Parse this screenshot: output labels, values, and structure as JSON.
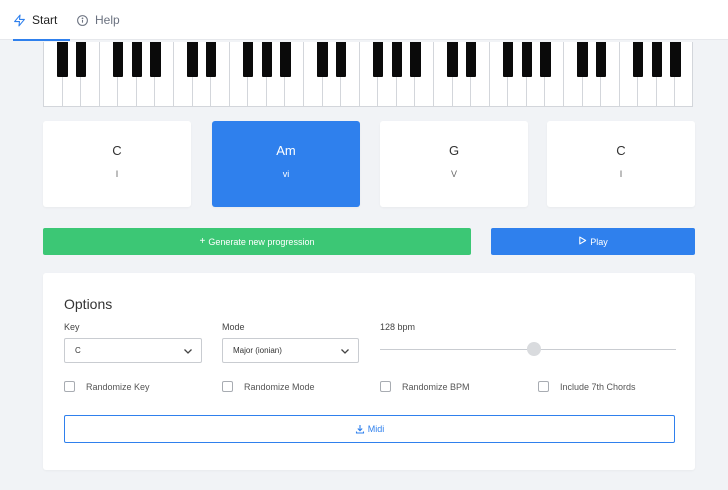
{
  "nav": {
    "tabs": [
      {
        "label": "Start",
        "icon": "lightning-icon",
        "active": true
      },
      {
        "label": "Help",
        "icon": "info-circle-icon",
        "active": false
      }
    ]
  },
  "piano": {
    "white_key_count": 35,
    "octaves": 5
  },
  "chords": [
    {
      "name": "C",
      "roman": "I",
      "active": false
    },
    {
      "name": "Am",
      "roman": "vi",
      "active": true
    },
    {
      "name": "G",
      "roman": "V",
      "active": false
    },
    {
      "name": "C",
      "roman": "I",
      "active": false
    }
  ],
  "actions": {
    "generate_label": "Generate new progression",
    "generate_icon": "plus-icon",
    "play_label": "Play",
    "play_icon": "play-icon"
  },
  "options": {
    "title": "Options",
    "key_label": "Key",
    "key_value": "C",
    "mode_label": "Mode",
    "mode_value": "Major (ionian)",
    "bpm_label": "128 bpm",
    "bpm_value": 128,
    "checkboxes": [
      {
        "label": "Randomize Key",
        "checked": false
      },
      {
        "label": "Randomize Mode",
        "checked": false
      },
      {
        "label": "Randomize BPM",
        "checked": false
      },
      {
        "label": "Include 7th Chords",
        "checked": false
      }
    ],
    "midi_label": "Midi",
    "midi_icon": "download-icon"
  },
  "colors": {
    "accent": "#2f80ed",
    "success": "#3cc775",
    "background": "#f1f3f6"
  }
}
